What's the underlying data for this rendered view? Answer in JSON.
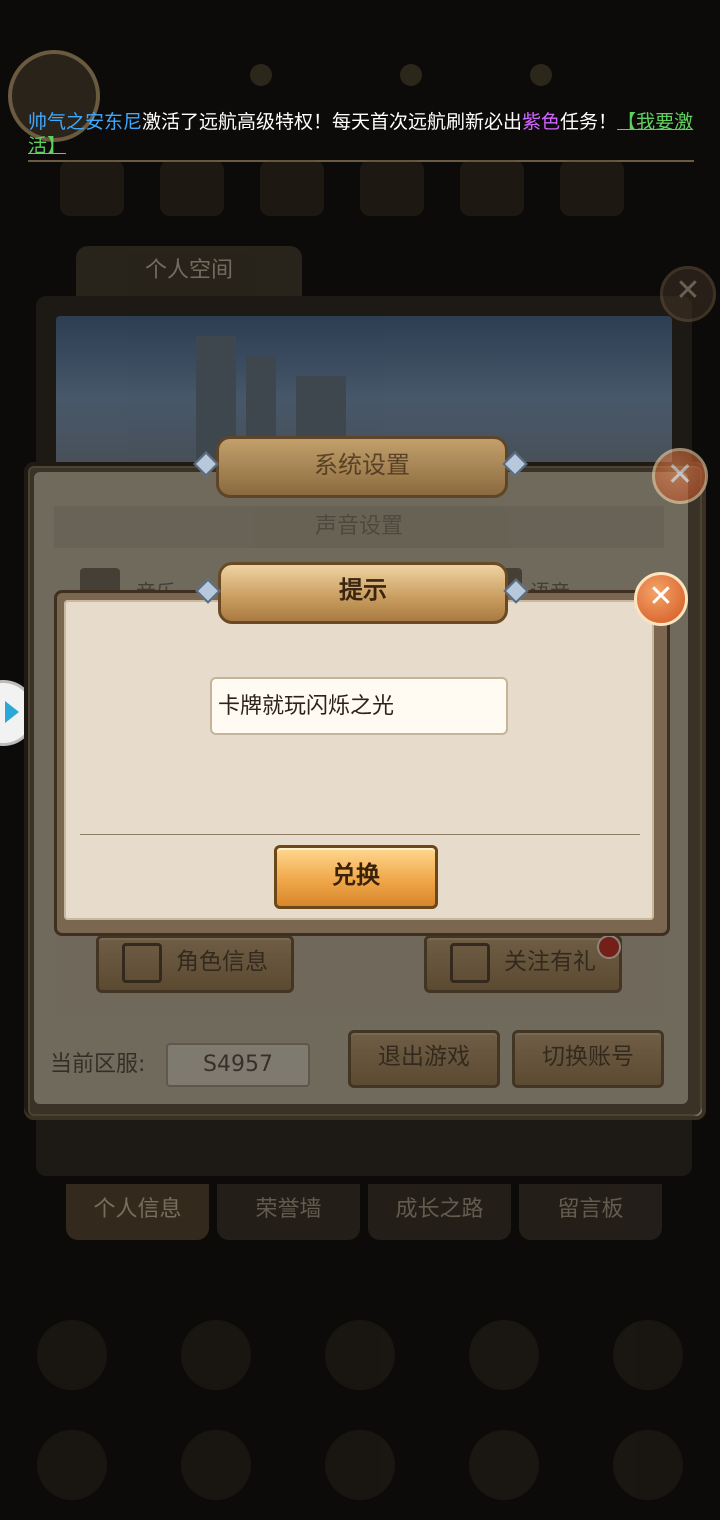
{
  "marquee": {
    "player_name": "帅气之安东尼",
    "text_1": "激活了远航高级特权！每天首次远航刷新必出",
    "purple_word": "紫色",
    "text_2": "任务！",
    "link": "【我要激活】"
  },
  "background": {
    "profile_tab": "个人空间",
    "bottom_tabs": [
      "个人信息",
      "荣誉墙",
      "成长之路",
      "留言板"
    ]
  },
  "settings_dialog": {
    "title": "系统设置",
    "sound_section": "声音设置",
    "music_label": "音乐",
    "voice_label": "语音",
    "role_info_button": "角色信息",
    "follow_gift_button": "关注有礼",
    "server_label": "当前区服:",
    "server_value": "S4957",
    "exit_game_button": "退出游戏",
    "switch_account_button": "切换账号"
  },
  "prompt_dialog": {
    "title": "提示",
    "code_value": "卡牌就玩闪烁之光",
    "redeem_button": "兑换"
  },
  "colors": {
    "player_name": "#3ea8ff",
    "purple_word": "#d066ff",
    "link": "#5fd15f",
    "close_button": "#d2561f",
    "redeem_button": "#f0a84a"
  }
}
